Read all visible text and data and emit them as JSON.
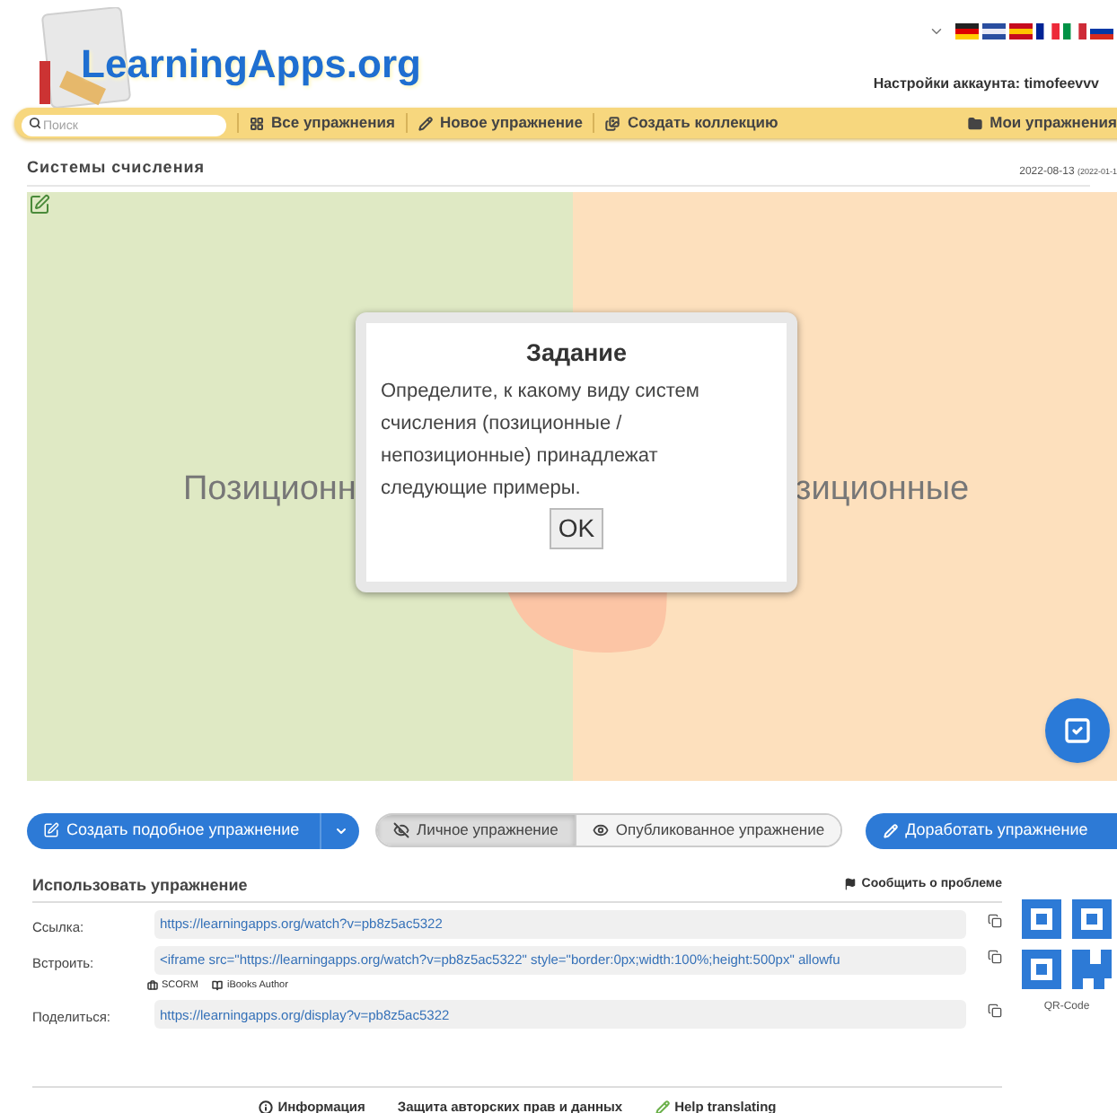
{
  "header": {
    "logo_text": "LearningApps.org",
    "account_label": "Настройки аккаунта: timofeevvv"
  },
  "nav": {
    "search": {
      "placeholder": "Поиск"
    },
    "items": [
      {
        "label": "Все упражнения"
      },
      {
        "label": "Новое упражнение"
      },
      {
        "label": "Создать коллекцию"
      }
    ],
    "right_item": {
      "label": "Мои упражнения"
    }
  },
  "exercise": {
    "title": "Системы счисления",
    "date": "2022-08-13",
    "date_extra": "(2022-01-1",
    "zones": [
      {
        "label": "Позиционн",
        "color": "#dfe9c4"
      },
      {
        "label": "зиционные",
        "color": "#fde0bd"
      }
    ],
    "dialog": {
      "title": "Задание",
      "text": "Определите, к какому виду систем счисления (позиционные / непозиционные) принадлежат следующие примеры.",
      "button": "OK"
    }
  },
  "actions": {
    "create_button": "Создать подобное упражнение",
    "visibility": [
      {
        "label": "Личное упражнение",
        "selected": true
      },
      {
        "label": "Опубликованное упражнение",
        "selected": false
      }
    ],
    "improve_button": "Доработать упражнение"
  },
  "use_section": {
    "title": "Использовать упражнение",
    "report": "Сообщить о проблеме",
    "rows": [
      {
        "label": "Ссылка:",
        "value": "https://learningapps.org/watch?v=pb8z5ac5322"
      },
      {
        "label": "Встроить:",
        "value": "<iframe src=\"https://learningapps.org/watch?v=pb8z5ac5322\" style=\"border:0px;width:100%;height:500px\" allowfu",
        "extras": [
          "SCORM",
          "iBooks Author"
        ]
      },
      {
        "label": "Поделиться:",
        "value": "https://learningapps.org/display?v=pb8z5ac5322"
      }
    ],
    "qr_label": "QR-Code"
  },
  "footer": {
    "links": [
      "Информация",
      "Защита авторских прав и данных",
      "Help translating"
    ]
  }
}
